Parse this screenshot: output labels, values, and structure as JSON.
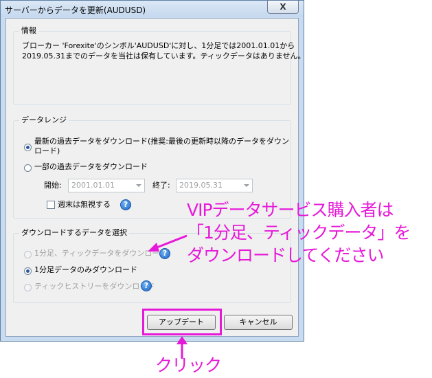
{
  "window": {
    "title": "サーバーからデータを更新(AUDUSD)",
    "close_label": "X"
  },
  "info": {
    "label": "情報",
    "line1": "ブローカー 'Forexite'のシンボル'AUDUSD'に対し、1分足では2001.01.01から",
    "line2": "2019.05.31までのデータを当社は保有しています。ティックデータはありません。"
  },
  "range": {
    "label": "データレンジ",
    "option_latest_line1": "最新の過去データをダウンロード(推奨:最後の更新時以降のデータをダウン",
    "option_latest_line2": "ロード)",
    "option_partial": "一部の過去データをダウンロード",
    "start_label": "開始:",
    "start_value": "2001.01.01",
    "end_label": "終了:",
    "end_value": "2019.05.31",
    "ignore_weekend": "週末は無視する"
  },
  "select": {
    "label": "ダウンロードするデータを選択",
    "option_tick_1m": "1分足、ティックデータをダウンロード",
    "option_1m_only": "1分足データのみダウンロード",
    "option_tick_history": "ティックヒストリーをダウンロード"
  },
  "buttons": {
    "update": "アップデート",
    "cancel": "キャンセル"
  },
  "help_glyph": "?",
  "annotation": {
    "line1": "VIPデータサービス購入者は",
    "line2": "「1分足、ティックデータ」を",
    "line3": "ダウンロードしてください",
    "click_label": "クリック"
  },
  "colors": {
    "annotation": "#e619d8"
  }
}
